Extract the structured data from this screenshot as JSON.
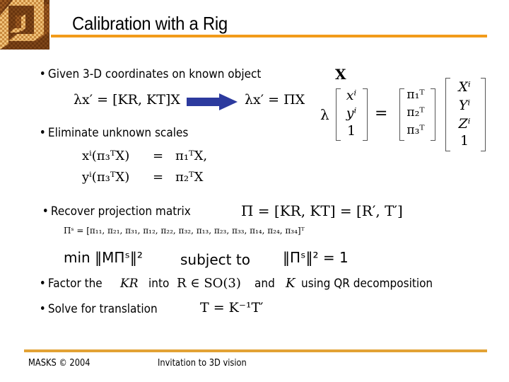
{
  "slide": {
    "title": "Calibration with a Rig",
    "logo_icon": "checkered-impossible-cube-logo",
    "accent_color": "#f29b1a",
    "bullets": [
      {
        "text": "Given 3-D coordinates on known object"
      },
      {
        "text": "Eliminate unknown scales"
      },
      {
        "text": "Recover projection matrix"
      },
      {
        "text_before": "Factor the",
        "text_mid": "into",
        "text_and": "and",
        "text_after": "using QR decomposition"
      },
      {
        "text": "Solve for translation"
      }
    ],
    "equations": {
      "projection_full": "λx′ = [KR, KT]X",
      "projection_short": "λx′ = ΠX",
      "X_label": "X",
      "matrix_eq": {
        "lambda": "λ",
        "lhs": [
          "xⁱ",
          "yⁱ",
          "1"
        ],
        "pi_rows": [
          "π₁ᵀ",
          "π₂ᵀ",
          "π₃ᵀ"
        ],
        "rhs": [
          "Xⁱ",
          "Yⁱ",
          "Zⁱ",
          "1"
        ]
      },
      "eliminate_1_lhs": "xⁱ(π₃ᵀX)",
      "eliminate_1_rhs": "π₁ᵀX,",
      "eliminate_2_lhs": "yⁱ(π₃ᵀX)",
      "eliminate_2_rhs": "π₂ᵀX",
      "equals": "=",
      "pi_def": "Π = [KR, KT] = [R′, T′]",
      "pi_s": "Πˢ = [π₁₁, π₂₁, π₃₁, π₁₂, π₂₂, π₃₂, π₁₃, π₂₃, π₃₃, π₁₄, π₂₄, π₃₄]ᵀ",
      "min_expr": "min ‖MΠˢ‖²",
      "subject_to": "subject to",
      "constraint": "‖Πˢ‖² = 1",
      "KR": "KR",
      "R_in_SO3": "R ∈ SO(3)",
      "K": "K",
      "translation": "T = K⁻¹T′"
    },
    "footer": {
      "left": "MASKS © 2004",
      "center": "Invitation to 3D vision"
    }
  }
}
